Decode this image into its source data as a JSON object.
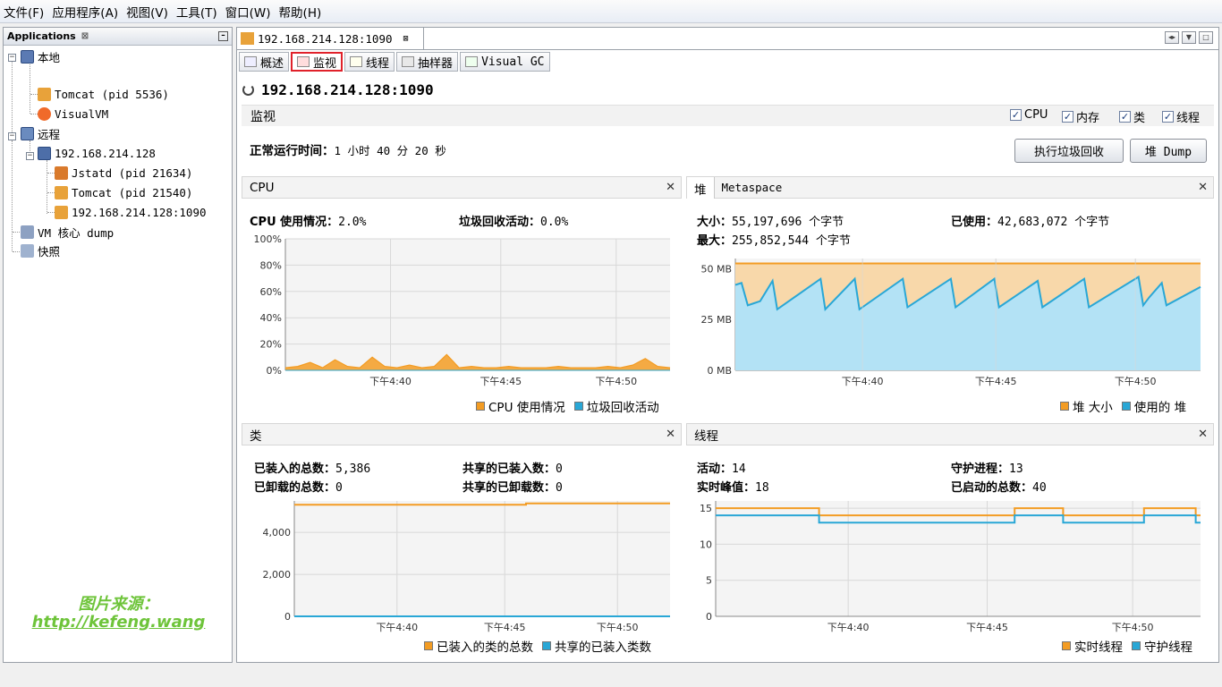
{
  "menu": [
    "文件(F)",
    "应用程序(A)",
    "视图(V)",
    "工具(T)",
    "窗口(W)",
    "帮助(H)"
  ],
  "sidebar": {
    "title": "Applications",
    "close_glyph": "⊠",
    "local_label": "本地",
    "local_items": [
      "Tomcat (pid 5536)",
      "VisualVM"
    ],
    "remote_label": "远程",
    "remote_host": "192.168.214.128",
    "remote_items": [
      "Jstatd (pid 21634)",
      "Tomcat (pid 21540)",
      "192.168.214.128:1090"
    ],
    "vm_dump": "VM 核心 dump",
    "snapshot": "快照"
  },
  "watermark": {
    "line1": "图片来源：",
    "line2": "http://kefeng.wang"
  },
  "doc_tab": "192.168.214.128:1090",
  "sub_tabs": [
    "概述",
    "监视",
    "线程",
    "抽样器",
    "Visual GC"
  ],
  "page_title": "192.168.214.128:1090",
  "monitor": {
    "heading": "监视",
    "checks": [
      "CPU",
      "内存",
      "类",
      "线程"
    ],
    "uptime_label": "正常运行时间：",
    "uptime_value": "1 小时 40 分 20 秒",
    "gc_button": "执行垃圾回收",
    "dump_button": "堆 Dump"
  },
  "cpu_panel": {
    "title": "CPU",
    "usage_label": "CPU 使用情况：",
    "usage_value": "2.0%",
    "gc_label": "垃圾回收活动：",
    "gc_value": "0.0%",
    "legend": [
      "CPU 使用情况",
      "垃圾回收活动"
    ]
  },
  "heap_panel": {
    "tab1": "堆",
    "tab2": "Metaspace",
    "size_label": "大小：",
    "size_value": "55,197,696 个字节",
    "used_label": "已使用：",
    "used_value": "42,683,072 个字节",
    "max_label": "最大：",
    "max_value": "255,852,544 个字节",
    "legend": [
      "堆 大小",
      "使用的 堆"
    ]
  },
  "class_panel": {
    "title": "类",
    "loaded_label": "已装入的总数：",
    "loaded_value": "5,386",
    "shared_loaded_label": "共享的已装入数：",
    "shared_loaded_value": "0",
    "unloaded_label": "已卸载的总数：",
    "unloaded_value": "0",
    "shared_unloaded_label": "共享的已卸载数：",
    "shared_unloaded_value": "0",
    "legend": [
      "已装入的类的总数",
      "共享的已装入类数"
    ]
  },
  "thread_panel": {
    "title": "线程",
    "live_label": "活动：",
    "live_value": "14",
    "daemon_label": "守护进程：",
    "daemon_value": "13",
    "peak_label": "实时峰值：",
    "peak_value": "18",
    "started_label": "已启动的总数：",
    "started_value": "40",
    "legend": [
      "实时线程",
      "守护线程"
    ]
  },
  "colors": {
    "orange": "#f39c23",
    "blue": "#29a7d6",
    "heap_fill": "#f8d8aa",
    "used_fill": "#b3e2f5"
  },
  "chart_data": [
    {
      "type": "line",
      "title": "CPU",
      "x_ticks": [
        "下午4:40",
        "下午4:45",
        "下午4:50"
      ],
      "y_ticks": [
        "0%",
        "20%",
        "40%",
        "60%",
        "80%",
        "100%"
      ],
      "ylim": [
        0,
        100
      ],
      "series": [
        {
          "name": "CPU 使用情况",
          "values": [
            2,
            3,
            6,
            2,
            8,
            3,
            2,
            10,
            3,
            2,
            4,
            2,
            3,
            12,
            2,
            3,
            2,
            2,
            3,
            2,
            2,
            2,
            3,
            2,
            2,
            2,
            3,
            2,
            4,
            9,
            3,
            2
          ]
        },
        {
          "name": "垃圾回收活动",
          "values": [
            0,
            0,
            0,
            0,
            0,
            0,
            0,
            0,
            0,
            0,
            0,
            0,
            0,
            0,
            0,
            0,
            0,
            0,
            0,
            0,
            0,
            0,
            0,
            0,
            0,
            0,
            0,
            0,
            0,
            0,
            0,
            0
          ]
        }
      ]
    },
    {
      "type": "area",
      "title": "堆",
      "x_ticks": [
        "下午4:40",
        "下午4:45",
        "下午4:50"
      ],
      "y_ticks": [
        "0 MB",
        "25 MB",
        "50 MB"
      ],
      "ylim": [
        0,
        55
      ],
      "series": [
        {
          "name": "堆 大小",
          "values": [
            52.6,
            52.6,
            52.6,
            52.6,
            52.6,
            52.6,
            52.6,
            52.6,
            52.6
          ]
        },
        {
          "name": "使用的 堆",
          "sawtooth_points": [
            [
              0,
              42
            ],
            [
              0.4,
              43
            ],
            [
              0.8,
              32
            ],
            [
              1.2,
              33
            ],
            [
              1.6,
              34
            ],
            [
              2.4,
              44
            ],
            [
              2.7,
              30
            ],
            [
              5.5,
              45
            ],
            [
              5.8,
              30
            ],
            [
              7.7,
              45
            ],
            [
              8,
              30
            ],
            [
              10.8,
              45
            ],
            [
              11.1,
              31
            ],
            [
              13.9,
              45
            ],
            [
              14.2,
              31
            ],
            [
              16.7,
              45
            ],
            [
              17,
              31
            ],
            [
              19.5,
              44
            ],
            [
              19.8,
              31
            ],
            [
              22.5,
              45
            ],
            [
              22.8,
              31
            ],
            [
              26,
              46
            ],
            [
              26.3,
              32
            ],
            [
              26.7,
              36
            ],
            [
              27.5,
              43
            ],
            [
              27.8,
              32
            ],
            [
              30,
              41
            ]
          ]
        }
      ]
    },
    {
      "type": "line",
      "title": "类",
      "x_ticks": [
        "下午4:40",
        "下午4:45",
        "下午4:50"
      ],
      "y_ticks": [
        "0",
        "2,000",
        "4,000"
      ],
      "ylim": [
        0,
        5500
      ],
      "series": [
        {
          "name": "已装入的类的总数",
          "steps": [
            [
              0,
              5320
            ],
            [
              18.5,
              5320
            ],
            [
              18.5,
              5386
            ],
            [
              30,
              5386
            ]
          ]
        },
        {
          "name": "共享的已装入类数",
          "steps": [
            [
              0,
              0
            ],
            [
              30,
              0
            ]
          ]
        }
      ]
    },
    {
      "type": "line",
      "title": "线程",
      "x_ticks": [
        "下午4:40",
        "下午4:45",
        "下午4:50"
      ],
      "y_ticks": [
        "0",
        "5",
        "10",
        "15"
      ],
      "ylim": [
        0,
        16
      ],
      "series": [
        {
          "name": "实时线程",
          "steps": [
            [
              0,
              15
            ],
            [
              6.4,
              15
            ],
            [
              6.4,
              14
            ],
            [
              18.5,
              14
            ],
            [
              18.5,
              15
            ],
            [
              21.5,
              15
            ],
            [
              21.5,
              14
            ],
            [
              26.5,
              14
            ],
            [
              26.5,
              15
            ],
            [
              29.7,
              15
            ],
            [
              29.7,
              14
            ],
            [
              30,
              14
            ]
          ]
        },
        {
          "name": "守护线程",
          "steps": [
            [
              0,
              14
            ],
            [
              6.4,
              14
            ],
            [
              6.4,
              13
            ],
            [
              18.5,
              13
            ],
            [
              18.5,
              14
            ],
            [
              21.5,
              14
            ],
            [
              21.5,
              13
            ],
            [
              26.5,
              13
            ],
            [
              26.5,
              14
            ],
            [
              29.7,
              14
            ],
            [
              29.7,
              13
            ],
            [
              30,
              13
            ]
          ]
        }
      ]
    }
  ]
}
